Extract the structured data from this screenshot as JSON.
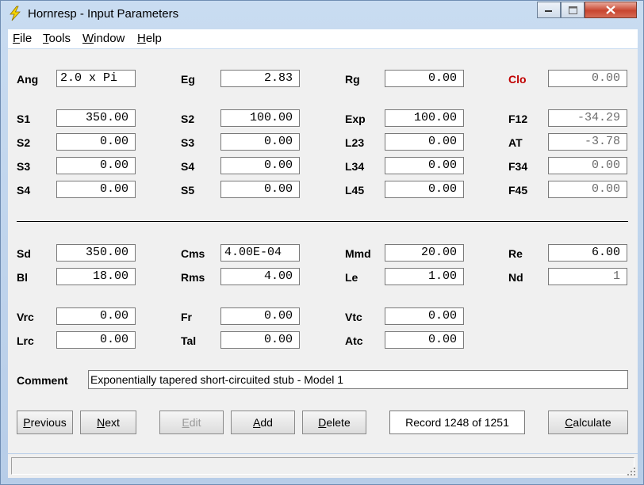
{
  "window": {
    "title": "Hornresp - Input Parameters"
  },
  "menu": [
    {
      "accel": "F",
      "rest": "ile"
    },
    {
      "accel": "T",
      "rest": "ools"
    },
    {
      "accel": "W",
      "rest": "indow"
    },
    {
      "accel": "H",
      "rest": "elp"
    }
  ],
  "params": {
    "row1": [
      {
        "label": "Ang",
        "value": "2.0 x Pi"
      },
      {
        "label": "Eg",
        "value": "2.83"
      },
      {
        "label": "Rg",
        "value": "0.00"
      },
      {
        "label": "Clo",
        "value": "0.00"
      }
    ],
    "row2": [
      {
        "label": "S1",
        "value": "350.00"
      },
      {
        "label": "S2",
        "value": "100.00"
      },
      {
        "label": "Exp",
        "value": "100.00"
      },
      {
        "label": "F12",
        "value": "-34.29"
      }
    ],
    "row3": [
      {
        "label": "S2",
        "value": "0.00"
      },
      {
        "label": "S3",
        "value": "0.00"
      },
      {
        "label": "L23",
        "value": "0.00"
      },
      {
        "label": "AT",
        "value": "-3.78"
      }
    ],
    "row4": [
      {
        "label": "S3",
        "value": "0.00"
      },
      {
        "label": "S4",
        "value": "0.00"
      },
      {
        "label": "L34",
        "value": "0.00"
      },
      {
        "label": "F34",
        "value": "0.00"
      }
    ],
    "row5": [
      {
        "label": "S4",
        "value": "0.00"
      },
      {
        "label": "S5",
        "value": "0.00"
      },
      {
        "label": "L45",
        "value": "0.00"
      },
      {
        "label": "F45",
        "value": "0.00"
      }
    ],
    "row6": [
      {
        "label": "Sd",
        "value": "350.00"
      },
      {
        "label": "Cms",
        "value": "4.00E-04"
      },
      {
        "label": "Mmd",
        "value": "20.00"
      },
      {
        "label": "Re",
        "value": "6.00"
      }
    ],
    "row7": [
      {
        "label": "Bl",
        "value": "18.00"
      },
      {
        "label": "Rms",
        "value": "4.00"
      },
      {
        "label": "Le",
        "value": "1.00"
      },
      {
        "label": "Nd",
        "value": "1"
      }
    ],
    "row8": [
      {
        "label": "Vrc",
        "value": "0.00"
      },
      {
        "label": "Fr",
        "value": "0.00"
      },
      {
        "label": "Vtc",
        "value": "0.00"
      }
    ],
    "row9": [
      {
        "label": "Lrc",
        "value": "0.00"
      },
      {
        "label": "Tal",
        "value": "0.00"
      },
      {
        "label": "Atc",
        "value": "0.00"
      }
    ]
  },
  "comment": {
    "label": "Comment",
    "value": "Exponentially tapered short-circuited stub - Model 1"
  },
  "buttons": {
    "previous": {
      "accel": "P",
      "rest": "revious"
    },
    "next": {
      "accel": "N",
      "rest": "ext"
    },
    "edit": {
      "accel": "E",
      "rest": "dit"
    },
    "add": {
      "accel": "A",
      "rest": "dd"
    },
    "delete": {
      "accel": "D",
      "rest": "elete"
    },
    "calculate": {
      "accel": "C",
      "rest": "alculate"
    }
  },
  "record": "Record 1248 of 1251",
  "colors": {
    "highlight_label": "#c00000",
    "readonly_text": "#6d6d6d",
    "title_gradient": "#c9dcf1"
  }
}
